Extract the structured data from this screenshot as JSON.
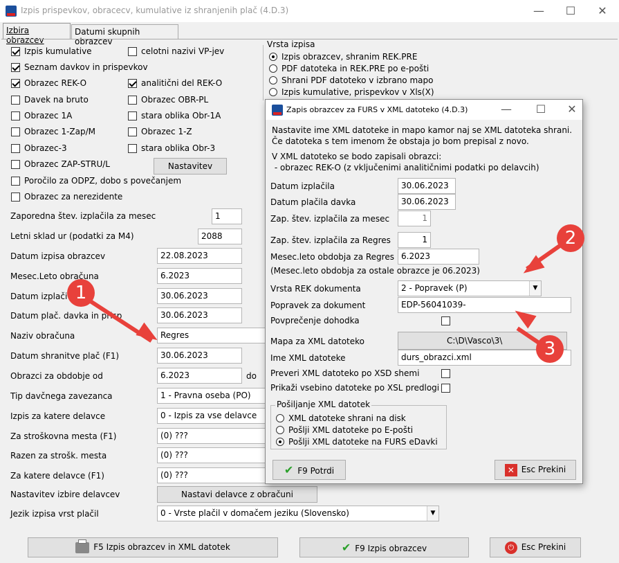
{
  "window": {
    "title": "Izpis prispevkov, obracecv, kumulative iz shranjenih plač  (4.D.3)",
    "minimize": "—",
    "maximize": "☐",
    "close": "✕"
  },
  "tabs": [
    "Izbira obrazcev",
    "Datumi skupnih obrazcev"
  ],
  "left_checks": [
    {
      "label": "Izpis kumulative",
      "checked": true
    },
    {
      "label": "Seznam davkov in prispevkov",
      "checked": true
    },
    {
      "label": "Obrazec REK-O",
      "checked": true
    },
    {
      "label": "Davek na bruto",
      "checked": false
    },
    {
      "label": "Obrazec 1A",
      "checked": false
    },
    {
      "label": "Obrazec 1-Zap/M",
      "checked": false
    },
    {
      "label": "Obrazec-3",
      "checked": false
    },
    {
      "label": "Obrazec ZAP-STRU/L",
      "checked": false
    },
    {
      "label": "Poročilo za ODPZ, dobo s povečanjem",
      "checked": false
    },
    {
      "label": "Obrazec za nerezidente",
      "checked": false
    }
  ],
  "mid_checks": [
    {
      "label": "celotni nazivi VP-jev",
      "checked": false
    },
    {
      "label": "analitični del REK-O",
      "checked": true
    },
    {
      "label": "Obrazec OBR-PL",
      "checked": false
    },
    {
      "label": "stara oblika Obr-1A",
      "checked": false
    },
    {
      "label": "Obrazec 1-Z",
      "checked": false
    },
    {
      "label": "stara oblika Obr-3",
      "checked": false
    }
  ],
  "nastavitev_button": "Nastavitev",
  "vrsta_izpisa": {
    "title": "Vrsta izpisa",
    "options": [
      {
        "label": "Izpis obrazcev, shranim REK.PRE",
        "selected": true
      },
      {
        "label": "PDF datoteka in REK.PRE po e-pošti",
        "selected": false
      },
      {
        "label": "Shrani PDF datoteko v izbrano mapo",
        "selected": false
      },
      {
        "label": "Izpis kumulative, prispevkov v Xls(X)",
        "selected": false
      }
    ]
  },
  "form": {
    "zap_stev_label": "Zaporedna štev. izplačila za mesec",
    "zap_stev": "1",
    "letni_sklad_label": "Letni sklad ur (podatki za M4)",
    "letni_sklad": "2088",
    "datum_izpisa_label": "Datum izpisa obrazcev",
    "datum_izpisa": "22.08.2023",
    "mesec_leto_label": "Mesec.Leto obračuna",
    "mesec_leto": "6.2023",
    "datum_izplacila_label": "Datum izplači",
    "datum_izplacila": "30.06.2023",
    "datum_plac_davka_label": "Datum plač. davka in prisp",
    "datum_plac_davka": "30.06.2023",
    "naziv_label": "Naziv obračuna",
    "naziv": "Regres",
    "datum_shranitve_label": "Datum shranitve plač (F1)",
    "datum_shranitve": "30.06.2023",
    "obdobje_label": "Obrazci za obdobje od",
    "obdobje_od": "6.2023",
    "do_label": "do",
    "tip_label": "Tip davčnega zavezanca",
    "tip": "1 - Pravna oseba (PO)",
    "izpis_delavce_label": "Izpis za katere delavce",
    "izpis_delavce": "0 - Izpis za vse delavce",
    "strosk_label": "Za stroškovna mesta (F1)",
    "strosk": "(0) ???",
    "razen_label": "Razen za strošk. mesta",
    "razen": "(0) ???",
    "katere_label": "Za katere delavce (F1)",
    "katere": "(0) ???",
    "nastavitev_izbire_label": "Nastavitev izbire delavcev",
    "nastavi_button": "Nastavi delavce z obračuni",
    "jezik_label": "Jezik izpisa vrst plačil",
    "jezik": "0 - Vrste plačil v domačem jeziku (Slovensko)"
  },
  "bottom": {
    "f5": "F5  Izpis obrazcev in XML datotek",
    "f9": "F9  Izpis obrazcev",
    "esc": "Esc  Prekini"
  },
  "dialog": {
    "title": "Zapis obrazcev za FURS v XML datoteko  (4.D.3)",
    "intro1": "Nastavite ime XML datoteke in mapo kamor naj se XML datoteka shrani.",
    "intro2": "Če datoteka s tem imenom že obstaja jo bom prepisal z novo.",
    "intro3": "V XML datoteko se bodo zapisali obrazci:",
    "intro4": " - obrazec REK-O (z vključenimi analitičnimi podatki po delavcih)",
    "datum_izplacila_label": "Datum izplačila",
    "datum_izplacila": "30.06.2023",
    "datum_placila_label": "Datum plačila davka",
    "datum_placila": "30.06.2023",
    "zap_mesec_label": "Zap. štev. izplačila za mesec",
    "zap_mesec": "1",
    "zap_regres_label": "Zap. štev. izplačila za Regres",
    "zap_regres": "1",
    "mesec_leto_label": "Mesec.leto obdobja za Regres",
    "mesec_leto": "6.2023",
    "mesec_leto_note": "(Mesec.leto obdobja za ostale obrazce je 06.2023)",
    "vrsta_rek_label": "Vrsta REK dokumenta",
    "vrsta_rek": "2 - Popravek (P)",
    "popravek_label": "Popravek za dokument",
    "popravek": "EDP-56041039-",
    "povprecenje_label": "Povprečenje dohodka",
    "mapa_label": "Mapa za XML datoteko",
    "mapa": "C:\\D\\Vasco\\3\\",
    "ime_label": "Ime XML datoteke",
    "ime": "durs_obrazci.xml",
    "preveri_label": "Preveri XML datoteko po XSD shemi",
    "prikazi_label": "Prikaži vsebino datoteke po XSL predlogi",
    "posiljanje_title": "Pošiljanje XML datotek",
    "posiljanje": [
      {
        "label": "XML datoteke shrani na disk",
        "selected": false
      },
      {
        "label": "Pošlji XML datoteke po E-pošti",
        "selected": false
      },
      {
        "label": "Pošlji XML datoteke na FURS eDavki",
        "selected": true
      }
    ],
    "potrdi": "F9 Potrdi",
    "prekini": "Esc Prekini"
  },
  "annotations": [
    "1",
    "2",
    "3"
  ],
  "colors": {
    "accent_red": "#e8413b",
    "check_green": "#2aa02a"
  }
}
